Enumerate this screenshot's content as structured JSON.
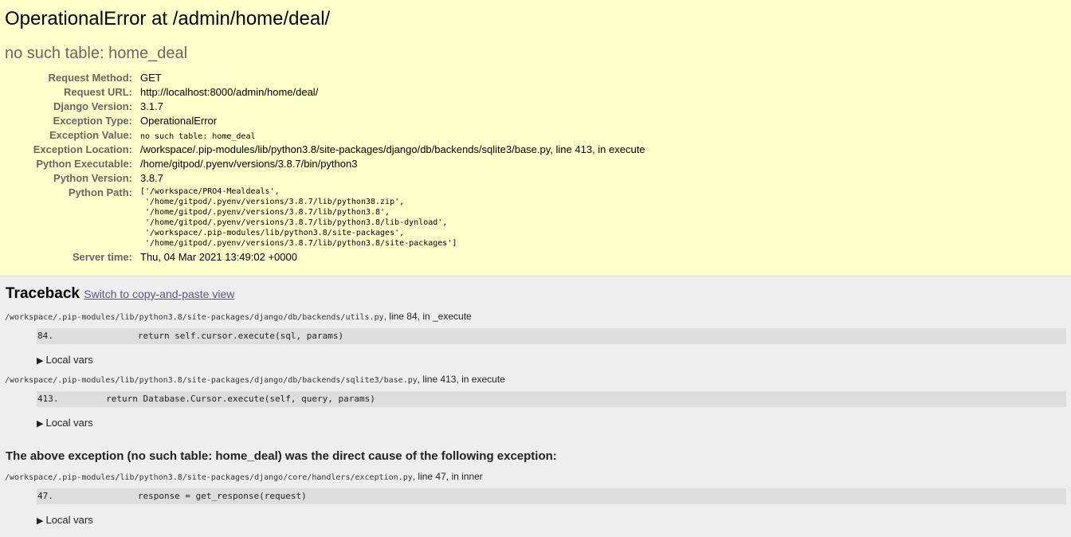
{
  "summary": {
    "title": "OperationalError at /admin/home/deal/",
    "subtitle": "no such table: home_deal",
    "meta": [
      {
        "label": "Request Method:",
        "value": "GET",
        "mono": false
      },
      {
        "label": "Request URL:",
        "value": "http://localhost:8000/admin/home/deal/",
        "mono": false
      },
      {
        "label": "Django Version:",
        "value": "3.1.7",
        "mono": false
      },
      {
        "label": "Exception Type:",
        "value": "OperationalError",
        "mono": false
      },
      {
        "label": "Exception Value:",
        "value": "no such table: home_deal",
        "mono": true
      },
      {
        "label": "Exception Location:",
        "value": "/workspace/.pip-modules/lib/python3.8/site-packages/django/db/backends/sqlite3/base.py, line 413, in execute",
        "mono": false
      },
      {
        "label": "Python Executable:",
        "value": "/home/gitpod/.pyenv/versions/3.8.7/bin/python3",
        "mono": false
      },
      {
        "label": "Python Version:",
        "value": "3.8.7",
        "mono": false
      },
      {
        "label": "Python Path:",
        "value": "['/workspace/PRO4-Mealdeals',\n '/home/gitpod/.pyenv/versions/3.8.7/lib/python38.zip',\n '/home/gitpod/.pyenv/versions/3.8.7/lib/python3.8',\n '/home/gitpod/.pyenv/versions/3.8.7/lib/python3.8/lib-dynload',\n '/workspace/.pip-modules/lib/python3.8/site-packages',\n '/home/gitpod/.pyenv/versions/3.8.7/lib/python3.8/site-packages']",
        "mono": true,
        "pre": true
      },
      {
        "label": "Server time:",
        "value": "Thu, 04 Mar 2021 13:49:02 +0000",
        "mono": false
      }
    ]
  },
  "traceback": {
    "heading": "Traceback",
    "switch_link": "Switch to copy-and-paste view",
    "frames": [
      {
        "path": "/workspace/.pip-modules/lib/python3.8/site-packages/django/db/backends/utils.py",
        "loc_suffix": ", line 84, in _execute",
        "code": "84.                return self.cursor.execute(sql, params)",
        "local_vars": "Local vars"
      },
      {
        "path": "/workspace/.pip-modules/lib/python3.8/site-packages/django/db/backends/sqlite3/base.py",
        "loc_suffix": ", line 413, in execute",
        "code": "413.         return Database.Cursor.execute(self, query, params)",
        "local_vars": "Local vars"
      }
    ],
    "cause_heading": "The above exception (no such table: home_deal) was the direct cause of the following exception:",
    "frames2": [
      {
        "path": "/workspace/.pip-modules/lib/python3.8/site-packages/django/core/handlers/exception.py",
        "loc_suffix": ", line 47, in inner",
        "code": "47.                response = get_response(request)",
        "local_vars": "Local vars"
      }
    ]
  },
  "icons": {
    "expand": "triangle-right-icon",
    "expand_glyph": "▶"
  }
}
